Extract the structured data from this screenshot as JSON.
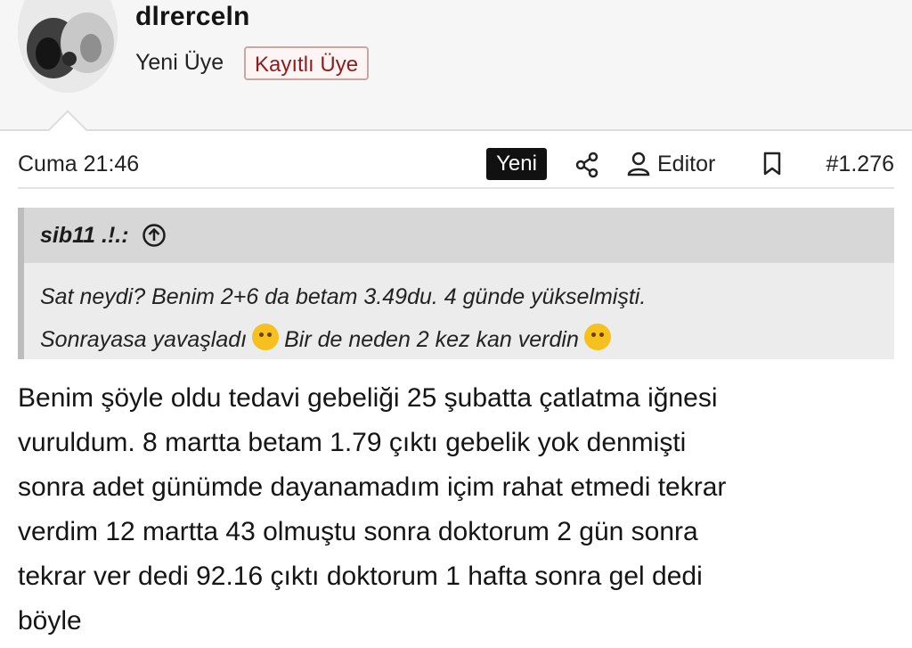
{
  "user": {
    "name": "dlrerceln",
    "role": "Yeni Üye",
    "badge": "Kayıtlı Üye"
  },
  "post": {
    "date": "Cuma 21:46",
    "new_label": "Yeni",
    "editor_label": "Editor",
    "number": "#1.276"
  },
  "quote": {
    "author": "sib11 .!.:",
    "line1": "Sat neydi? Benim 2+6 da betam 3.49du. 4 günde yükselmişti.",
    "line2_a": "Sonrayasa yavaşladı",
    "line2_b": "Bir de neden 2 kez kan verdin"
  },
  "message": {
    "lines": [
      "Benim şöyle oldu tedavi gebeliği 25 şubatta çatlatma iğnesi",
      "vuruldum. 8 martta betam 1.79 çıktı gebelik yok denmişti",
      "sonra adet günümde dayanamadım içim rahat etmedi tekrar",
      "verdim 12 martta 43 olmuştu sonra doktorum 2 gün sonra",
      "tekrar ver dedi 92.16 çıktı doktorum 1 hafta sonra gel dedi",
      "böyle"
    ]
  },
  "icons": {
    "share": "share-icon",
    "user": "user-icon",
    "bookmark": "bookmark-icon",
    "arrow_up": "arrow-up-circle-icon",
    "laugh_emoji": "tears-of-joy-emoji",
    "think_emoji": "thinking-emoji"
  }
}
